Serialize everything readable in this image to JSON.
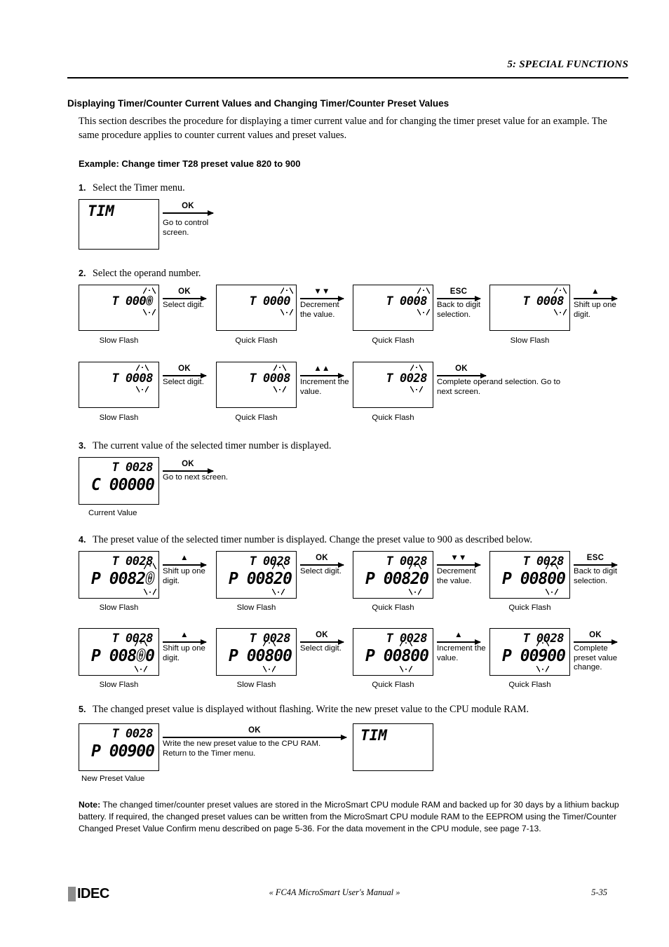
{
  "header": {
    "chapter_num": "5:",
    "chapter_title_first": "S",
    "chapter_title": "5: SPECIAL FUNCTIONS",
    "title_parts": [
      "5: S",
      "PECIAL ",
      "F",
      "UNCTIONS"
    ]
  },
  "section": {
    "heading": "Displaying Timer/Counter Current Values and Changing Timer/Counter Preset Values",
    "intro": "This section describes the procedure for displaying a timer current value and for changing the timer preset value for an example. The same procedure applies to counter current values and preset values.",
    "example_heading": "Example: Change timer T28 preset value 820 to 900"
  },
  "steps": {
    "s1": {
      "num": "1.",
      "text": "Select the Timer menu."
    },
    "s2": {
      "num": "2.",
      "text": "Select the operand number."
    },
    "s3": {
      "num": "3.",
      "text": "The current value of the selected timer number is displayed."
    },
    "s4": {
      "num": "4.",
      "text": "The preset value of the selected timer number is displayed. Change the preset value to 900 as described below."
    },
    "s5": {
      "num": "5.",
      "text": "The changed preset value is displayed without flashing. Write the new preset value to the CPU module RAM."
    }
  },
  "labels": {
    "slow_flash": "Slow Flash",
    "quick_flash": "Quick Flash",
    "current_value": "Current Value",
    "new_preset_value": "New Preset Value"
  },
  "keys": {
    "ok": "OK",
    "esc": "ESC",
    "down_double": "▼▼",
    "up_double": "▲▲",
    "up": "▲"
  },
  "step1": {
    "lcd_text": "TIM",
    "arrow": {
      "key": "OK",
      "desc": "Go to control screen."
    }
  },
  "step2_row1": {
    "lcd1": {
      "prefix": "T",
      "digits": "0000",
      "flash_index": 3,
      "flash_style": "hollow",
      "caption": "Slow Flash"
    },
    "a1": {
      "key": "OK",
      "desc": "Select digit."
    },
    "lcd2": {
      "prefix": "T",
      "digits": "0000",
      "flash_index": 3,
      "flash_style": "solid",
      "caption": "Quick Flash"
    },
    "a2": {
      "key": "▼▼",
      "desc": "Decrement the value."
    },
    "lcd3": {
      "prefix": "T",
      "digits": "0008",
      "flash_index": 3,
      "flash_style": "solid",
      "caption": "Quick Flash"
    },
    "a3": {
      "key": "ESC",
      "desc": "Back to digit selection."
    },
    "lcd4": {
      "prefix": "T",
      "digits": "0008",
      "flash_index": 3,
      "flash_style": "solid",
      "caption": "Slow Flash"
    },
    "a4": {
      "key": "▲",
      "desc": "Shift up one digit."
    }
  },
  "step2_row2": {
    "lcd1": {
      "prefix": "T",
      "digits": "0008",
      "flash_index": 2,
      "flash_style": "solid",
      "caption": "Slow Flash"
    },
    "a1": {
      "key": "OK",
      "desc": "Select digit."
    },
    "lcd2": {
      "prefix": "T",
      "digits": "0008",
      "flash_index": 2,
      "flash_style": "solid",
      "caption": "Quick Flash"
    },
    "a2": {
      "key": "▲▲",
      "desc": "Increment the value."
    },
    "lcd3": {
      "prefix": "T",
      "digits": "0028",
      "flash_index": 2,
      "flash_style": "solid",
      "caption": "Quick Flash"
    },
    "a3": {
      "key": "OK",
      "desc": "Complete operand selection. Go to next screen."
    }
  },
  "step3": {
    "lcd": {
      "line1_prefix": "T",
      "line1_digits": "0028",
      "line2_prefix": "C",
      "line2_digits": "00000",
      "caption": "Current Value"
    },
    "arrow": {
      "key": "OK",
      "desc": "Go to next screen."
    }
  },
  "step4_row1": {
    "lcd1": {
      "line1": "T 0028",
      "prefix": "P",
      "digits": "00820",
      "flash_index": 4,
      "caption": "Slow Flash"
    },
    "a1": {
      "key": "▲",
      "desc": "Shift up one digit."
    },
    "lcd2": {
      "line1": "T 0028",
      "prefix": "P",
      "digits": "00820",
      "flash_index": 3,
      "caption": "Slow Flash"
    },
    "a2": {
      "key": "OK",
      "desc": "Select digit."
    },
    "lcd3": {
      "line1": "T 0028",
      "prefix": "P",
      "digits": "00820",
      "flash_index": 3,
      "caption": "Quick Flash"
    },
    "a3": {
      "key": "▼▼",
      "desc": "Decrement the value."
    },
    "lcd4": {
      "line1": "T 0028",
      "prefix": "P",
      "digits": "00800",
      "flash_index": 3,
      "caption": "Quick Flash"
    },
    "a4": {
      "key": "ESC",
      "desc": "Back to digit selection."
    }
  },
  "step4_row2": {
    "lcd1": {
      "line1": "T 0028",
      "prefix": "P",
      "digits": "00800",
      "flash_index": 3,
      "caption": "Slow Flash"
    },
    "a1": {
      "key": "▲",
      "desc": "Shift up one digit."
    },
    "lcd2": {
      "line1": "T 0028",
      "prefix": "P",
      "digits": "00800",
      "flash_index": 2,
      "caption": "Slow Flash"
    },
    "a2": {
      "key": "OK",
      "desc": "Select digit."
    },
    "lcd3": {
      "line1": "T 0028",
      "prefix": "P",
      "digits": "00800",
      "flash_index": 2,
      "caption": "Quick Flash"
    },
    "a3": {
      "key": "▲",
      "desc": "Increment the value."
    },
    "lcd4": {
      "line1": "T 0028",
      "prefix": "P",
      "digits": "00900",
      "flash_index": 2,
      "caption": "Quick Flash"
    },
    "a4": {
      "key": "OK",
      "desc": "Complete preset value change."
    }
  },
  "step5": {
    "lcd": {
      "line1": "T 0028",
      "line2": "P 00900",
      "caption": "New Preset Value"
    },
    "arrow": {
      "key": "OK",
      "desc1": "Write the new preset value to the CPU RAM.",
      "desc2": "Return to the Timer menu."
    },
    "lcd_menu": "TIM"
  },
  "note": {
    "label": "Note:",
    "text": " The changed timer/counter preset values are stored in the MicroSmart CPU module RAM and backed up for 30 days by a lithium backup battery. If required, the changed preset values can be written from the MicroSmart CPU module RAM to the EEPROM using the Timer/Counter Changed Preset Value Confirm menu described on page 5-36. For the data movement in the CPU module, see page 7-13."
  },
  "footer": {
    "logo_text": "IDEC",
    "manual_open": "« ",
    "manual_title": "FC4A MicroSmart User's Manual",
    "manual_close": " »",
    "page_number": "5-35"
  }
}
